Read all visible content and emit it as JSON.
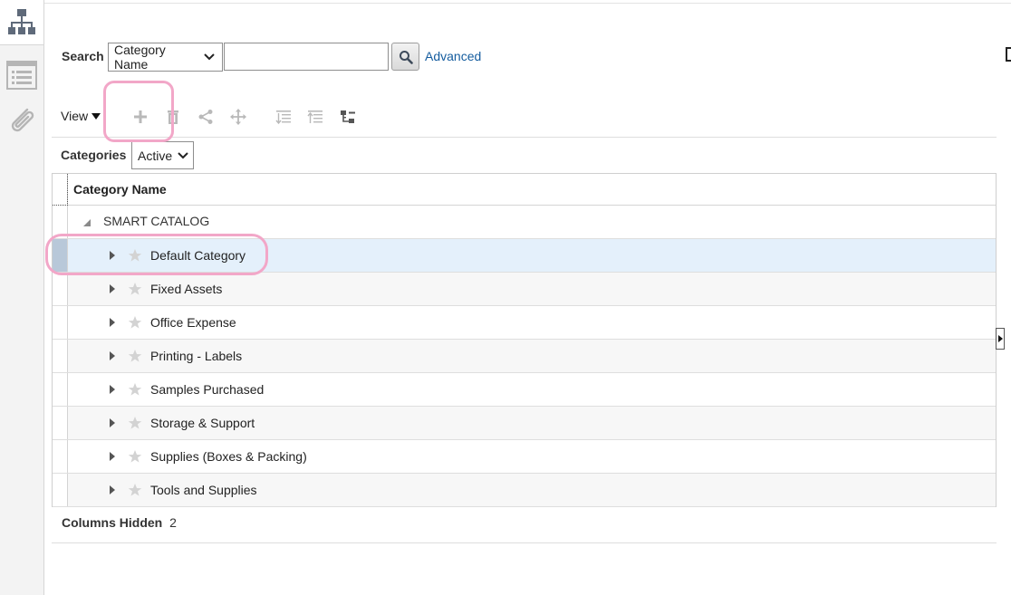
{
  "rail": {
    "items": [
      {
        "icon": "hierarchy-icon",
        "active": true
      },
      {
        "icon": "list-icon",
        "active": false
      },
      {
        "icon": "paperclip-icon",
        "active": false
      }
    ]
  },
  "search": {
    "label": "Search",
    "field_select": "Category Name",
    "input_value": "",
    "advanced_label": "Advanced"
  },
  "toolbar": {
    "view_label": "View",
    "icons": [
      "add-icon",
      "delete-icon",
      "share-icon",
      "move-icon",
      "expand-all-icon",
      "collapse-all-icon",
      "tree-icon"
    ]
  },
  "filter": {
    "label": "Categories",
    "status_select": "Active"
  },
  "table": {
    "column_header": "Category Name",
    "root": "SMART CATALOG",
    "rows": [
      {
        "name": "Default Category"
      },
      {
        "name": "Fixed Assets"
      },
      {
        "name": "Office Expense"
      },
      {
        "name": "Printing - Labels"
      },
      {
        "name": "Samples Purchased"
      },
      {
        "name": "Storage & Support"
      },
      {
        "name": "Supplies (Boxes & Packing)"
      },
      {
        "name": "Tools and Supplies"
      }
    ]
  },
  "footer": {
    "columns_hidden_label": "Columns Hidden",
    "columns_hidden_count": "2"
  },
  "colors": {
    "link": "#145c9e",
    "selected_row": "#e4f0fb",
    "annotation": "#f2a7c8"
  }
}
